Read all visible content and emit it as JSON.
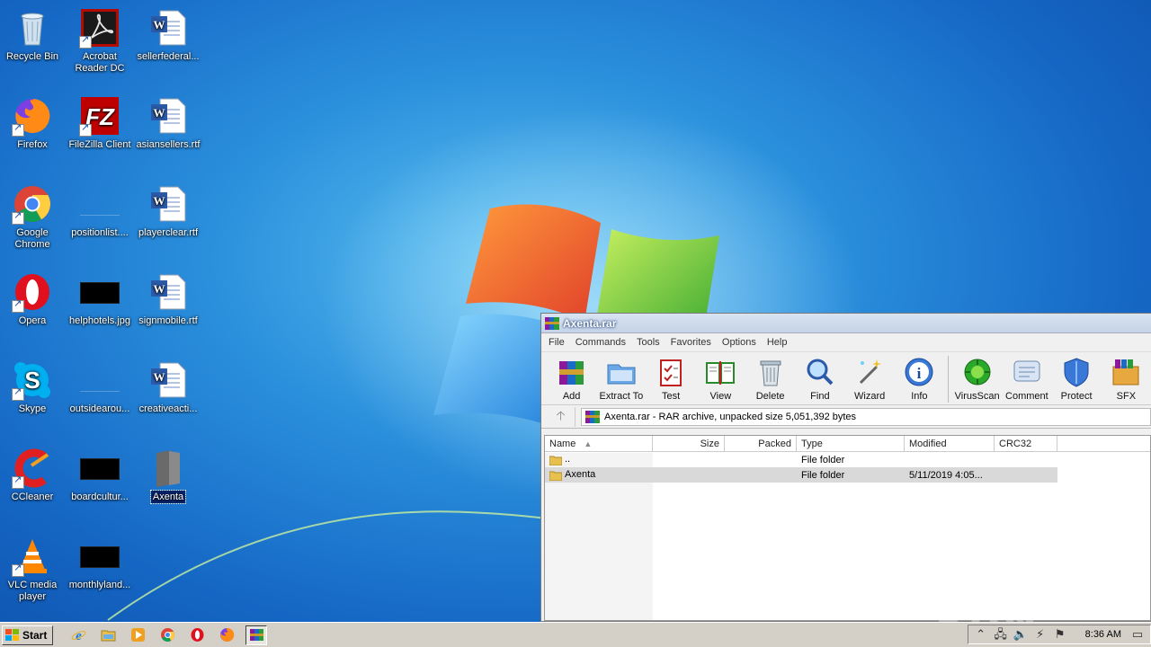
{
  "desktop": {
    "icons": [
      {
        "label": "Recycle Bin"
      },
      {
        "label": "Acrobat Reader DC"
      },
      {
        "label": "sellerfederal..."
      },
      {
        "label": "Firefox"
      },
      {
        "label": "FileZilla Client"
      },
      {
        "label": "asiansellers.rtf"
      },
      {
        "label": "Google Chrome"
      },
      {
        "label": "positionlist...."
      },
      {
        "label": "playerclear.rtf"
      },
      {
        "label": "Opera"
      },
      {
        "label": "helphotels.jpg"
      },
      {
        "label": "signmobile.rtf"
      },
      {
        "label": "Skype"
      },
      {
        "label": "outsidearou..."
      },
      {
        "label": "creativeacti..."
      },
      {
        "label": "CCleaner"
      },
      {
        "label": "boardcultur..."
      },
      {
        "label": "Axenta"
      },
      {
        "label": "VLC media player"
      },
      {
        "label": "monthlyland..."
      }
    ]
  },
  "winrar": {
    "title": "Axenta.rar",
    "menu": [
      "File",
      "Commands",
      "Tools",
      "Favorites",
      "Options",
      "Help"
    ],
    "toolbar": [
      "Add",
      "Extract To",
      "Test",
      "View",
      "Delete",
      "Find",
      "Wizard",
      "Info",
      "VirusScan",
      "Comment",
      "Protect",
      "SFX"
    ],
    "path": "Axenta.rar - RAR archive, unpacked size 5,051,392 bytes",
    "columns": [
      "Name",
      "Size",
      "Packed",
      "Type",
      "Modified",
      "CRC32"
    ],
    "rows": [
      {
        "name": "..",
        "size": "",
        "packed": "",
        "type": "File folder",
        "modified": "",
        "crc": ""
      },
      {
        "name": "Axenta",
        "size": "",
        "packed": "",
        "type": "File folder",
        "modified": "5/11/2019 4:05...",
        "crc": ""
      }
    ]
  },
  "watermark": "ANY RUN",
  "taskbar": {
    "start": "Start",
    "clock": "8:36 AM"
  },
  "colors": {
    "desktop_blue": "#1566c4",
    "selection": "#0a246a"
  }
}
